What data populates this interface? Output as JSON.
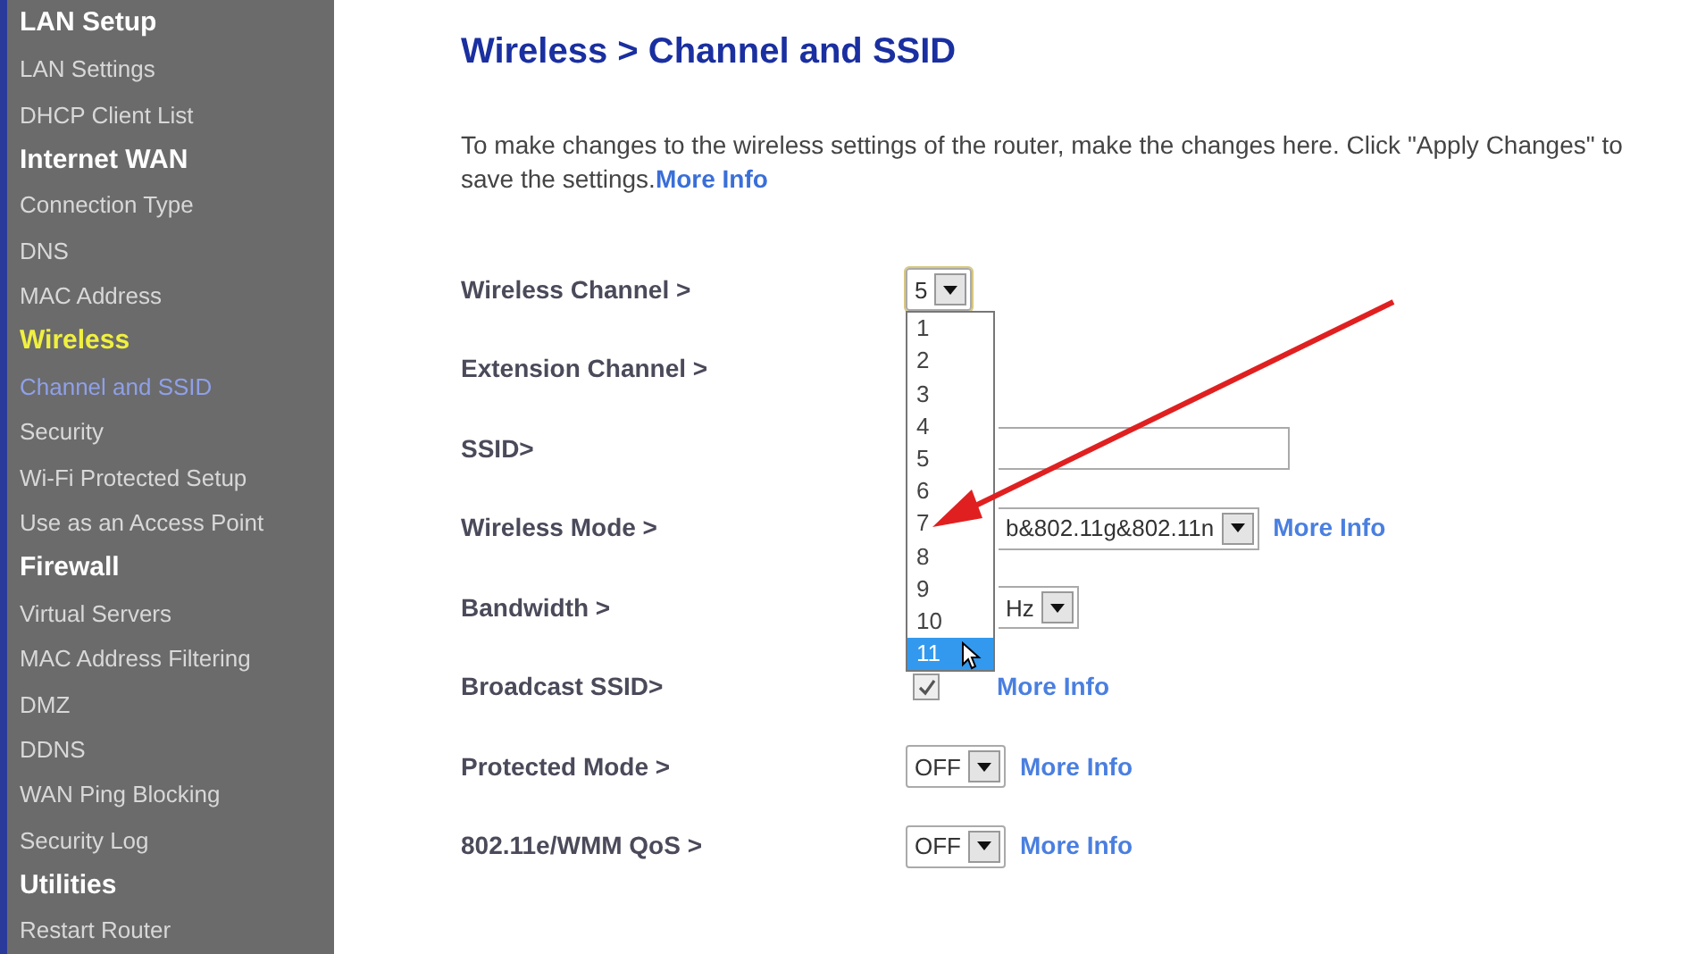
{
  "sidebar": {
    "items": [
      {
        "kind": "heading",
        "label": "LAN Setup",
        "selected": false
      },
      {
        "kind": "link",
        "label": "LAN Settings",
        "selected": false
      },
      {
        "kind": "link",
        "label": "DHCP Client List",
        "selected": false
      },
      {
        "kind": "heading",
        "label": "Internet WAN",
        "selected": false
      },
      {
        "kind": "link",
        "label": "Connection Type",
        "selected": false
      },
      {
        "kind": "link",
        "label": "DNS",
        "selected": false
      },
      {
        "kind": "link",
        "label": "MAC Address",
        "selected": false
      },
      {
        "kind": "heading",
        "label": "Wireless",
        "selected": true
      },
      {
        "kind": "link",
        "label": "Channel and SSID",
        "selected": true
      },
      {
        "kind": "link",
        "label": "Security",
        "selected": false
      },
      {
        "kind": "link",
        "label": "Wi-Fi Protected Setup",
        "selected": false
      },
      {
        "kind": "link",
        "label": "Use as an Access Point",
        "selected": false
      },
      {
        "kind": "heading",
        "label": "Firewall",
        "selected": false
      },
      {
        "kind": "link",
        "label": "Virtual Servers",
        "selected": false
      },
      {
        "kind": "link",
        "label": "MAC Address Filtering",
        "selected": false
      },
      {
        "kind": "link",
        "label": "DMZ",
        "selected": false
      },
      {
        "kind": "link",
        "label": "DDNS",
        "selected": false
      },
      {
        "kind": "link",
        "label": "WAN Ping Blocking",
        "selected": false
      },
      {
        "kind": "link",
        "label": "Security Log",
        "selected": false
      },
      {
        "kind": "heading",
        "label": "Utilities",
        "selected": false
      },
      {
        "kind": "link",
        "label": "Restart Router",
        "selected": false
      }
    ]
  },
  "page": {
    "title": "Wireless > Channel and SSID",
    "intro": "To make changes to the wireless settings of the router, make the changes here. Click \"Apply Changes\" to save the settings.",
    "intro_link": "More Info"
  },
  "form": {
    "rows": [
      {
        "label": "Wireless Channel >",
        "kind": "select",
        "value": "5",
        "partly_hidden": false,
        "open": true
      },
      {
        "label": "Extension Channel >",
        "kind": "hidden"
      },
      {
        "label": "SSID>",
        "kind": "input",
        "partly_hidden": true
      },
      {
        "label": "Wireless Mode >",
        "kind": "select",
        "value": "b&802.11g&802.11n",
        "partly_hidden": true,
        "open": false,
        "link": "More Info"
      },
      {
        "label": "Bandwidth >",
        "kind": "select",
        "value": "Hz",
        "partly_hidden": true,
        "open": false
      },
      {
        "label": "Broadcast SSID>",
        "kind": "checkbox",
        "checked": true,
        "link": "More Info"
      },
      {
        "label": "Protected Mode >",
        "kind": "select",
        "value": "OFF",
        "partly_hidden": false,
        "open": false,
        "link": "More Info"
      },
      {
        "label": "802.11e/WMM QoS >",
        "kind": "select",
        "value": "OFF",
        "partly_hidden": false,
        "open": false,
        "link": "More Info"
      }
    ]
  },
  "channel_options": [
    {
      "label": "1",
      "selected": false
    },
    {
      "label": "2",
      "selected": false
    },
    {
      "label": "3",
      "selected": false
    },
    {
      "label": "4",
      "selected": false
    },
    {
      "label": "5",
      "selected": false
    },
    {
      "label": "6",
      "selected": false
    },
    {
      "label": "7",
      "selected": false
    },
    {
      "label": "8",
      "selected": false
    },
    {
      "label": "9",
      "selected": false
    },
    {
      "label": "10",
      "selected": false
    },
    {
      "label": "11",
      "selected": true
    }
  ]
}
